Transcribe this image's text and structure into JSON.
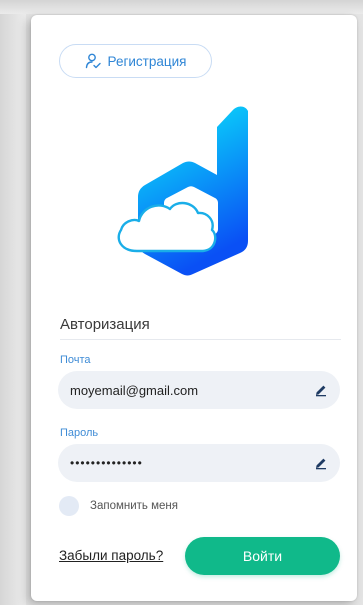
{
  "header": {
    "register_label": "Регистрация"
  },
  "auth": {
    "title": "Авторизация",
    "email_label": "Почта",
    "email_value": "moyemail@gmail.com",
    "password_label": "Пароль",
    "password_value": "••••••••••••••",
    "remember_label": "Запомнить меня",
    "forgot_label": "Забыли пароль?",
    "login_label": "Войти"
  },
  "icons": {
    "register": "user-check-icon",
    "edit": "pencil-icon",
    "logo": "cloud-d-logo"
  },
  "colors": {
    "accent_blue": "#2f86d6",
    "button_green": "#10b98a",
    "field_bg": "#eef1f6",
    "logo_gradient_top": "#0af1fb",
    "logo_gradient_bottom": "#0a50f5"
  }
}
